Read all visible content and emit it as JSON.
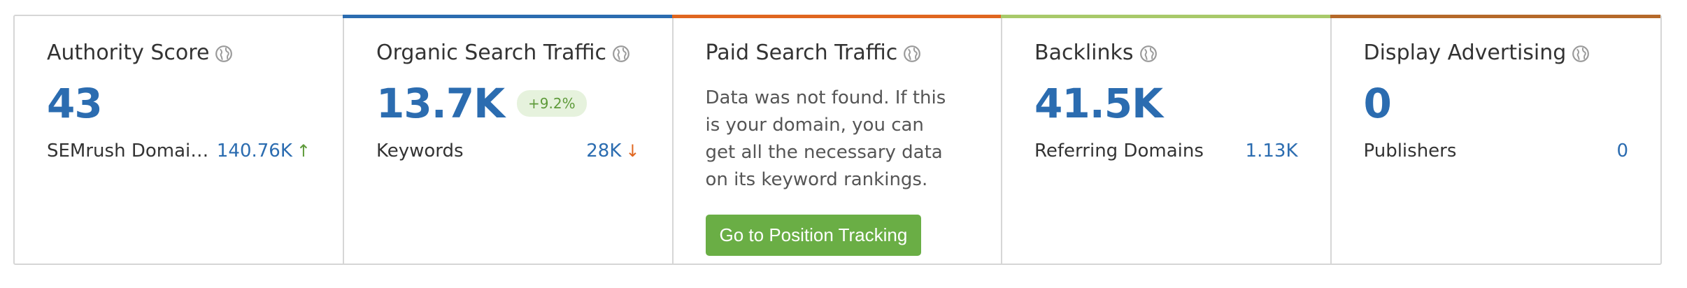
{
  "colors": {
    "primary_value": "#2b6cb0",
    "organic_bar": "#2b6cb0",
    "paid_bar": "#e0661f",
    "backlinks_bar": "#a8c96a",
    "display_bar": "#b5692a",
    "button_bg": "#6aae45",
    "up_arrow": "#5e9a3a",
    "down_arrow": "#e0661f"
  },
  "cards": {
    "authority": {
      "title": "Authority Score",
      "icon": "globe-icon",
      "value": "43",
      "sub_label": "SEMrush Domain…",
      "sub_value": "140.76K",
      "trend": "↑"
    },
    "organic": {
      "title": "Organic Search Traffic",
      "icon": "globe-icon",
      "value": "13.7K",
      "badge": "+9.2%",
      "sub_label": "Keywords",
      "sub_value": "28K",
      "trend": "↓"
    },
    "paid": {
      "title": "Paid Search Traffic",
      "icon": "globe-icon",
      "message": "Data was not found. If this is your domain, you can get all the necessary data on its keyword rankings.",
      "button_label": "Go to Position Tracking"
    },
    "backlinks": {
      "title": "Backlinks",
      "icon": "globe-icon",
      "value": "41.5K",
      "sub_label": "Referring Domains",
      "sub_value": "1.13K"
    },
    "display": {
      "title": "Display Advertising",
      "icon": "globe-icon",
      "value": "0",
      "sub_label": "Publishers",
      "sub_value": "0"
    }
  }
}
